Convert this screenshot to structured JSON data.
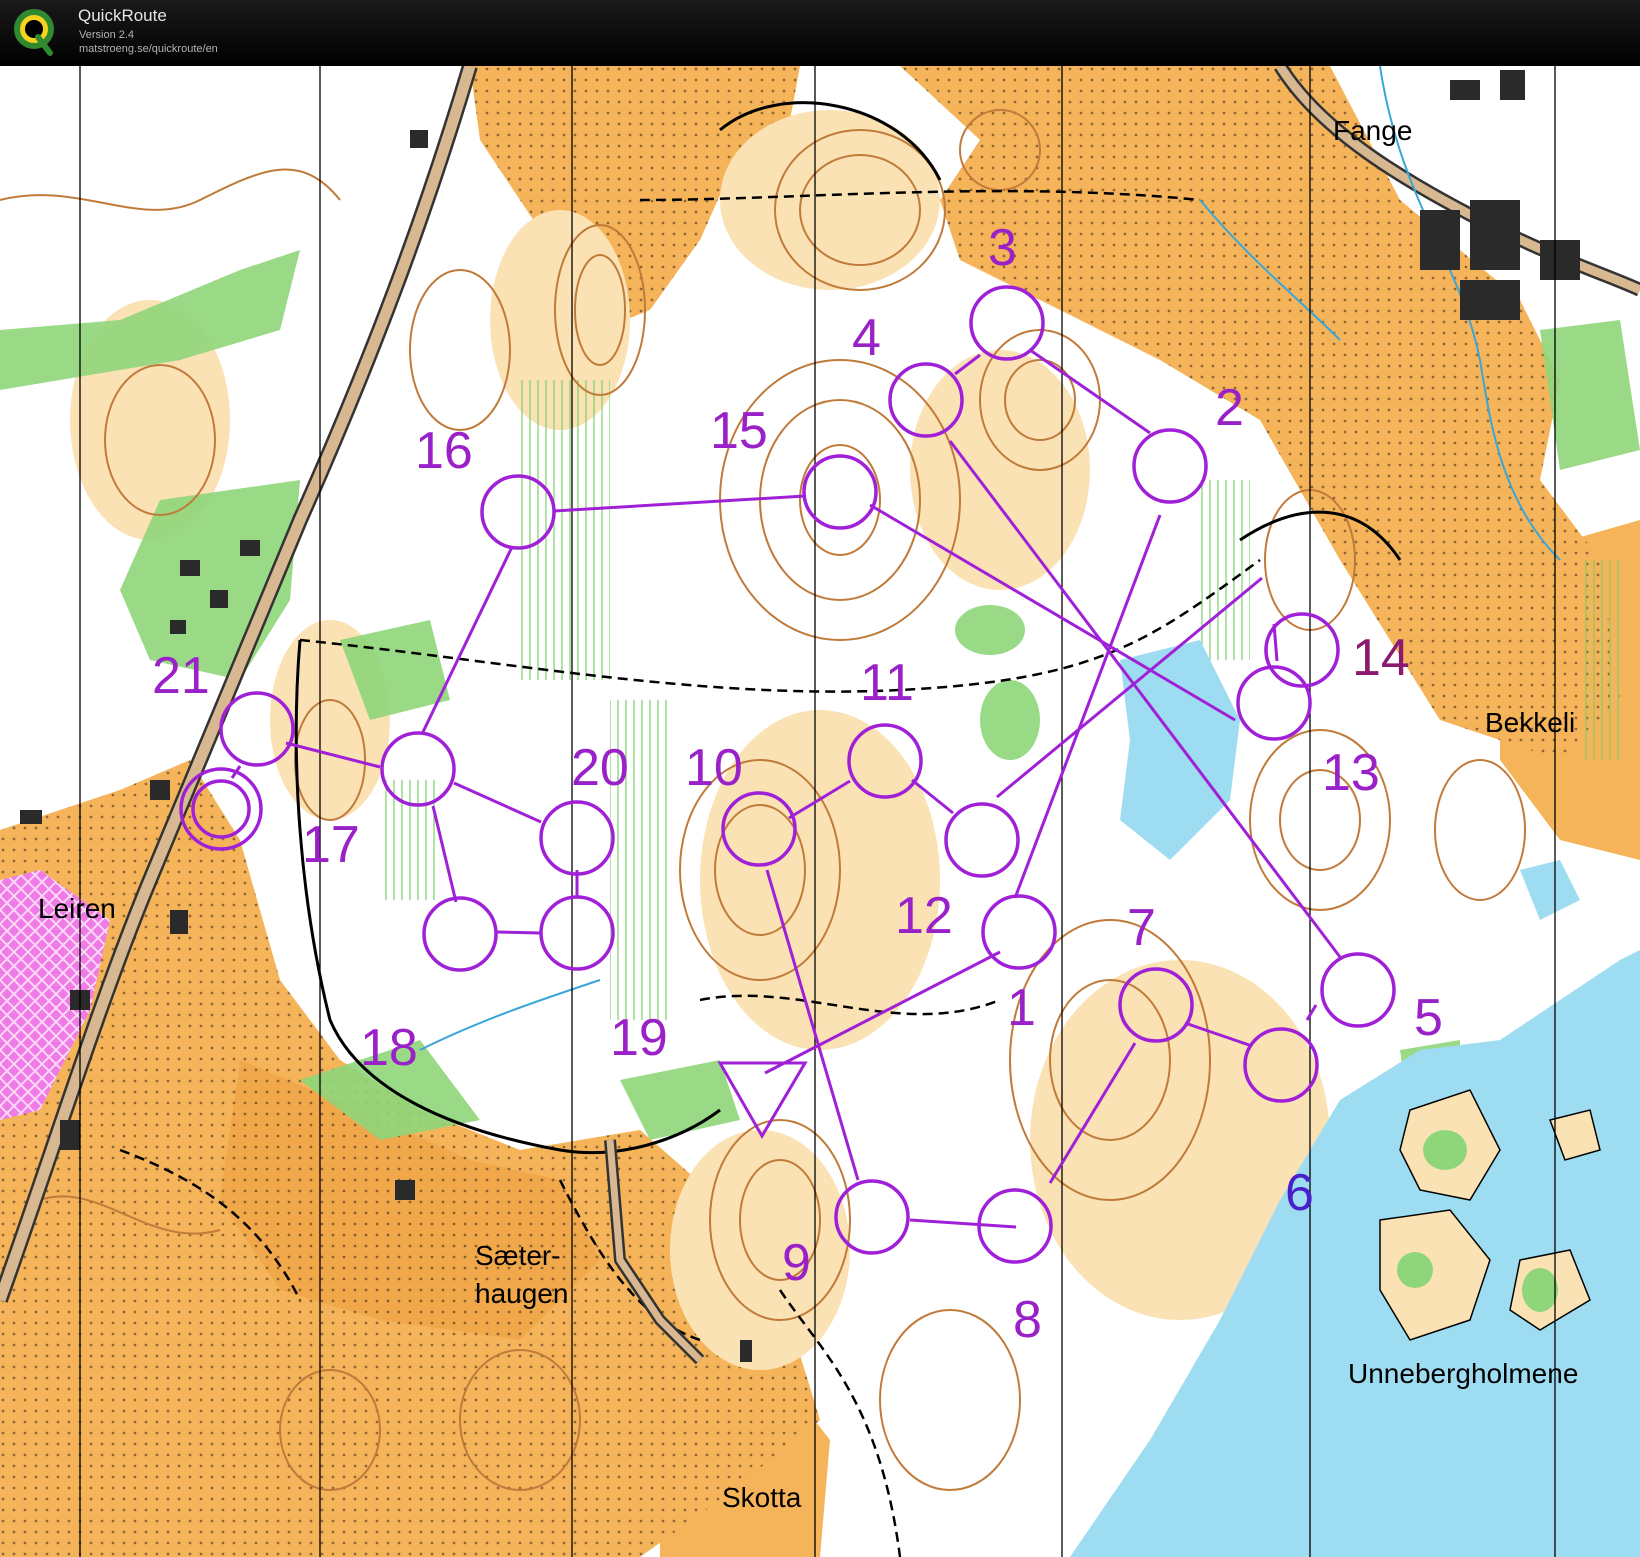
{
  "app": {
    "name": "QuickRoute",
    "version": "Version 2.4",
    "url": "matstroeng.se/quickroute/en",
    "logo_letter": "Q"
  },
  "map": {
    "colors": {
      "course": "#a020d8",
      "field": "#f6b45a",
      "open_land": "#fbe2b4",
      "forest": "#ffffff",
      "green": "#8fd67a",
      "water": "#9edcf2",
      "contour": "#c07a3a",
      "building": "#2a2a2a",
      "restricted": "#f07ae6",
      "start_triangle": "#d86a2a"
    },
    "place_names": {
      "fange": "Fange",
      "bekkeli": "Bekkeli",
      "leiren": "Leiren",
      "saeter_line1": "Sæter-",
      "saeter_line2": "haugen",
      "skotta": "Skotta",
      "unnebergholmene": "Unnebergholmene"
    },
    "control_numbers": {
      "c1": "1",
      "c2": "2",
      "c3": "3",
      "c4": "4",
      "c5": "5",
      "c6": "6",
      "c7": "7",
      "c8": "8",
      "c9": "9",
      "c10": "10",
      "c11": "11",
      "c12": "12",
      "c13": "13",
      "c14": "14",
      "c15": "15",
      "c16": "16",
      "c17": "17",
      "c18": "18",
      "c19": "19",
      "c20": "20",
      "c21": "21"
    }
  }
}
